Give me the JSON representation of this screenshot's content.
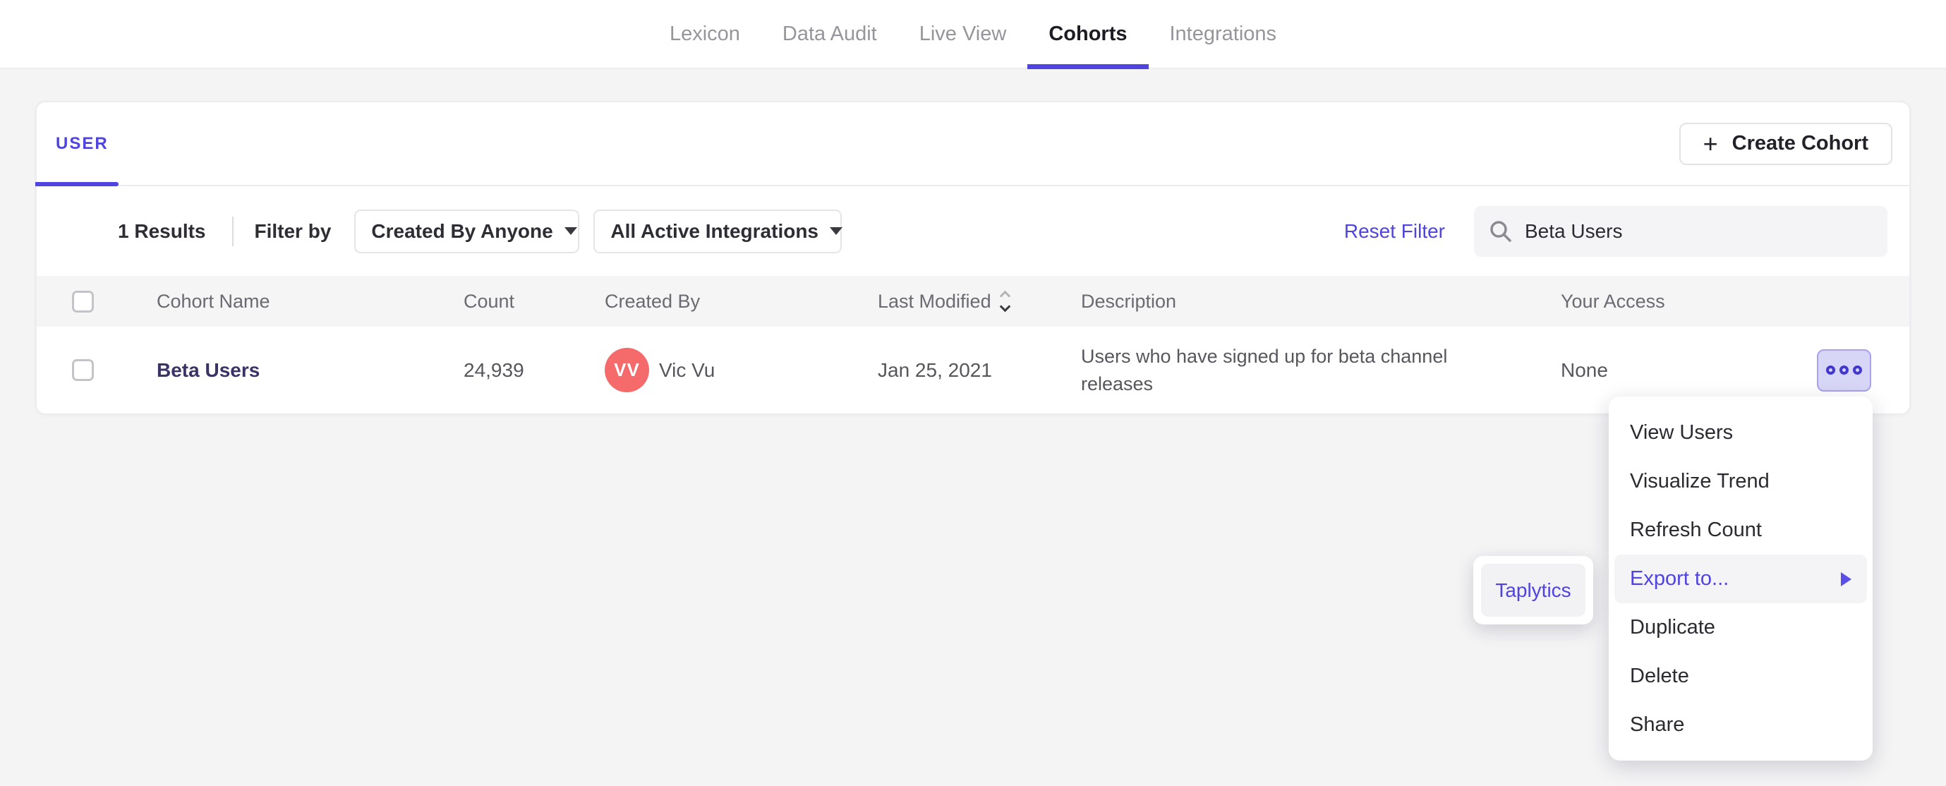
{
  "nav": {
    "active_tab": "Cohorts",
    "tabs": [
      {
        "label": "Lexicon"
      },
      {
        "label": "Data Audit"
      },
      {
        "label": "Live View"
      },
      {
        "label": "Cohorts"
      },
      {
        "label": "Integrations"
      }
    ]
  },
  "card": {
    "tab_label": "USER",
    "create_button": {
      "icon": "+",
      "label": "Create Cohort"
    },
    "filter_bar": {
      "results": "1 Results",
      "filter_by_label": "Filter by",
      "created_by_dropdown": "Created By Anyone",
      "integrations_dropdown": "All Active Integrations",
      "reset_filter": "Reset Filter",
      "search_value": "Beta Users"
    },
    "table": {
      "headers": {
        "name": "Cohort Name",
        "count": "Count",
        "created_by": "Created By",
        "last_modified": "Last Modified",
        "description": "Description",
        "access": "Your Access"
      },
      "rows": [
        {
          "name": "Beta Users",
          "count": "24,939",
          "avatar_initials": "VV",
          "created_by": "Vic Vu",
          "last_modified": "Jan 25, 2021",
          "description": "Users who have signed up for beta channel releases",
          "access": "None"
        }
      ]
    }
  },
  "context_menu": {
    "highlighted": "Export to...",
    "items": [
      {
        "label": "View Users"
      },
      {
        "label": "Visualize Trend"
      },
      {
        "label": "Refresh Count"
      },
      {
        "label": "Export to...",
        "has_submenu": true
      },
      {
        "label": "Duplicate"
      },
      {
        "label": "Delete"
      },
      {
        "label": "Share"
      }
    ]
  },
  "export_submenu": {
    "items": [
      {
        "label": "Taplytics"
      }
    ]
  },
  "colors": {
    "accent": "#4f44e0",
    "avatar": "#f56a6a",
    "dots_button_bg": "#d8d6f6"
  }
}
